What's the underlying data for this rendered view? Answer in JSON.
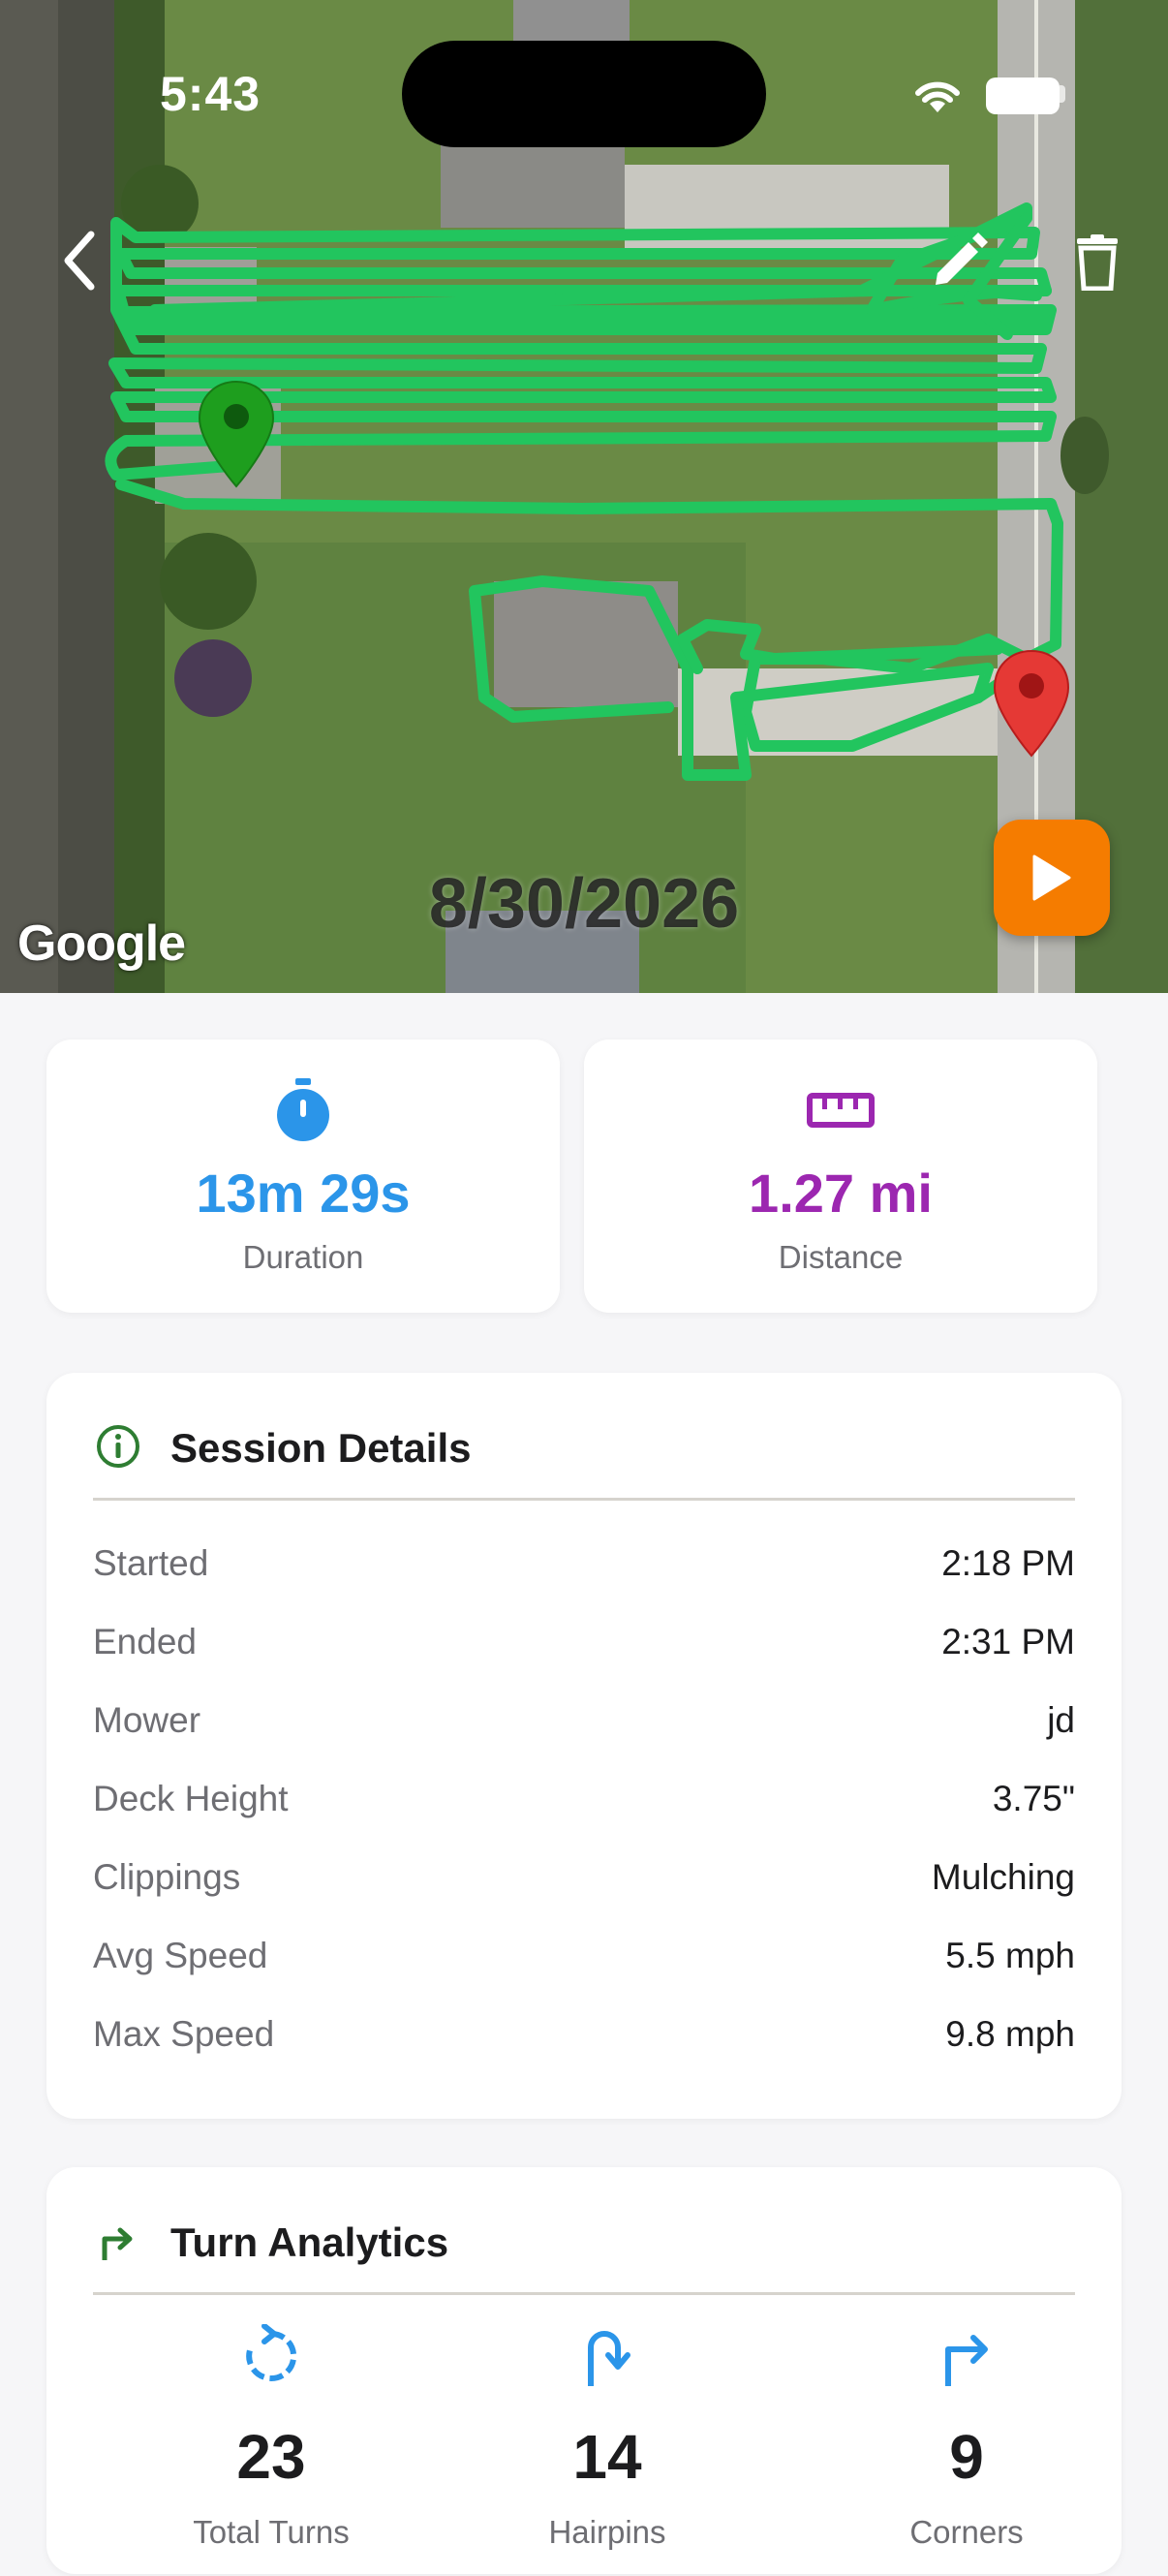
{
  "status_bar": {
    "time": "5:43"
  },
  "map": {
    "attribution": "Google",
    "date": "8/30/2026"
  },
  "stats": {
    "duration": {
      "value": "13m 29s",
      "label": "Duration",
      "color": "#2b95e9"
    },
    "distance": {
      "value": "1.27 mi",
      "label": "Distance",
      "color": "#9c27b0"
    }
  },
  "session_details": {
    "title": "Session Details",
    "rows": [
      {
        "label": "Started",
        "value": "2:18 PM"
      },
      {
        "label": "Ended",
        "value": "2:31 PM"
      },
      {
        "label": "Mower",
        "value": "jd"
      },
      {
        "label": "Deck Height",
        "value": "3.75\""
      },
      {
        "label": "Clippings",
        "value": "Mulching"
      },
      {
        "label": "Avg Speed",
        "value": "5.5 mph"
      },
      {
        "label": "Max Speed",
        "value": "9.8 mph"
      }
    ]
  },
  "turn_analytics": {
    "title": "Turn Analytics",
    "items": [
      {
        "value": "23",
        "label": "Total Turns"
      },
      {
        "value": "14",
        "label": "Hairpins"
      },
      {
        "value": "9",
        "label": "Corners"
      }
    ]
  },
  "colors": {
    "accent_green": "#2e7d32",
    "track_green": "#22c55e",
    "play_orange": "#f57c00",
    "blue": "#2b95e9",
    "purple": "#9c27b0"
  }
}
